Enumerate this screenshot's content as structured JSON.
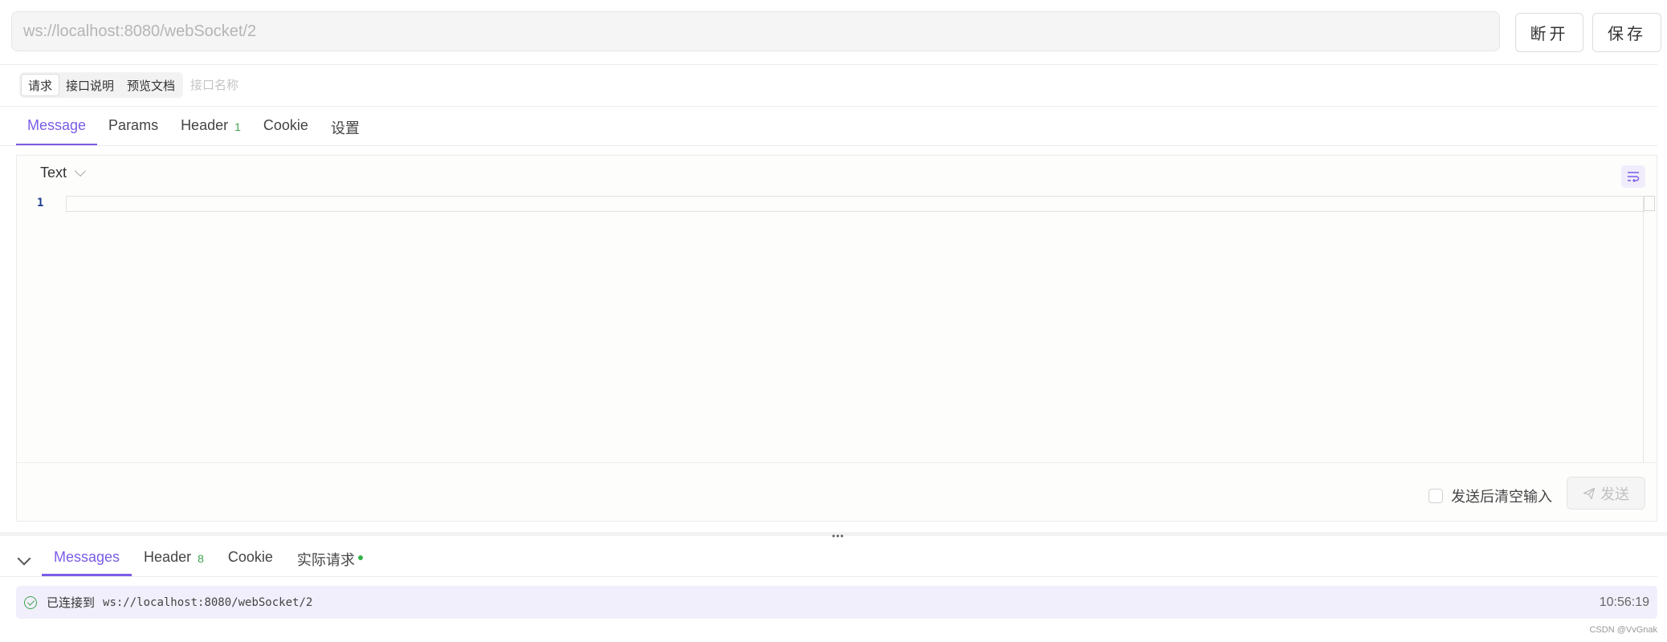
{
  "url_bar": {
    "value": "ws://localhost:8080/webSocket/2"
  },
  "toolbar": {
    "disconnect_label": "断开",
    "save_label": "保存"
  },
  "segments": [
    {
      "label": "请求",
      "active": true
    },
    {
      "label": "接口说明",
      "active": false
    },
    {
      "label": "预览文档",
      "active": false
    }
  ],
  "name_input": {
    "placeholder": "接口名称"
  },
  "tabs": [
    {
      "label": "Message",
      "active": true
    },
    {
      "label": "Params"
    },
    {
      "label": "Header",
      "count": "1"
    },
    {
      "label": "Cookie"
    },
    {
      "label": "设置"
    }
  ],
  "editor": {
    "format": "Text",
    "line_numbers": [
      "1"
    ],
    "wrap_icon": "wrap-lines-icon"
  },
  "footer": {
    "clear_after_send_label": "发送后清空输入",
    "send_label": "发送",
    "send_icon": "paper-plane-icon"
  },
  "splitter": {
    "grip": "•••"
  },
  "bottom_tabs": [
    {
      "label": "Messages",
      "active": true
    },
    {
      "label": "Header",
      "count": "8"
    },
    {
      "label": "Cookie"
    },
    {
      "label": "实际请求",
      "status_dot": true
    }
  ],
  "messages": [
    {
      "status_icon": "check-circle-icon",
      "text": "已连接到",
      "url": "ws://localhost:8080/webSocket/2",
      "time": "10:56:19"
    }
  ],
  "watermark": "CSDN @VvGnak",
  "colors": {
    "accent": "#7b5ce6",
    "success": "#3fa34d",
    "message_bg": "#f1effb"
  }
}
